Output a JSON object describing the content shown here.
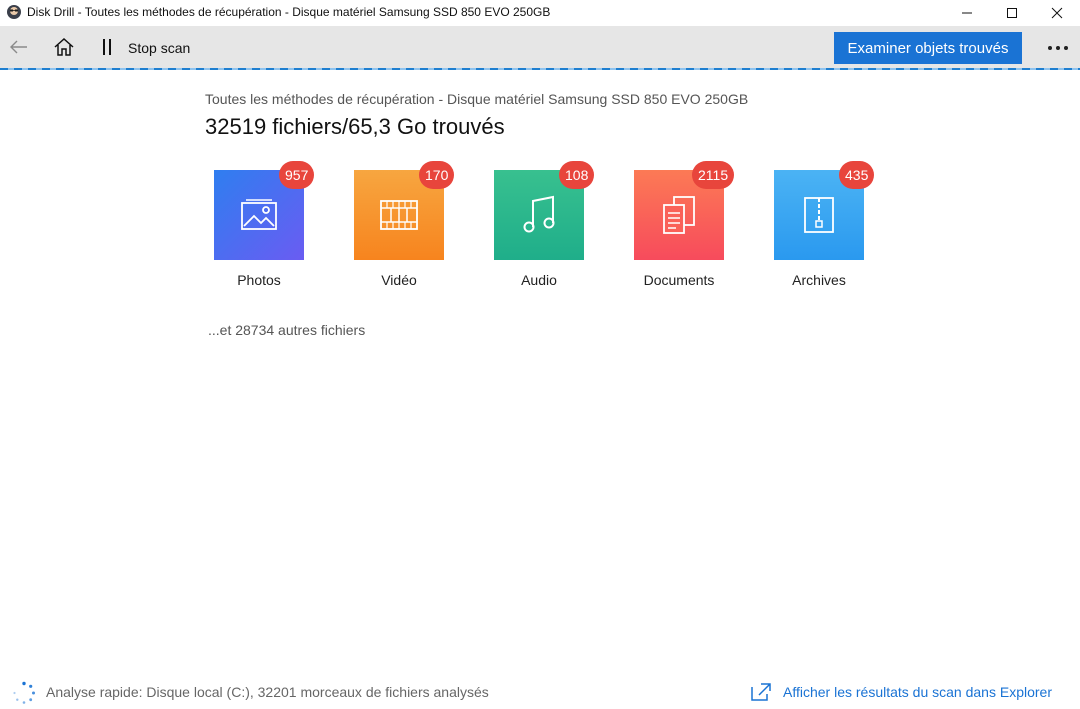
{
  "window": {
    "title": "Disk Drill - Toutes les méthodes de récupération - Disque matériel Samsung SSD 850 EVO 250GB"
  },
  "toolbar": {
    "stop_label": "Stop scan",
    "examine_label": "Examiner objets trouvés",
    "accent": "#1a73d4"
  },
  "main": {
    "subtitle": "Toutes les méthodes de récupération - Disque matériel Samsung SSD 850 EVO 250GB",
    "heading": "32519 fichiers/65,3 Go trouvés",
    "categories": [
      {
        "label": "Photos",
        "count": "957",
        "icon": "image-icon"
      },
      {
        "label": "Vidéo",
        "count": "170",
        "icon": "film-icon"
      },
      {
        "label": "Audio",
        "count": "108",
        "icon": "music-note-icon"
      },
      {
        "label": "Documents",
        "count": "2115",
        "icon": "documents-icon"
      },
      {
        "label": "Archives",
        "count": "435",
        "icon": "archive-zip-icon"
      }
    ],
    "others": "...et 28734 autres fichiers"
  },
  "status": {
    "text": "Analyse rapide: Disque local (C:), 32201 morceaux de fichiers analysés",
    "link": "Afficher les résultats du scan dans Explorer"
  }
}
